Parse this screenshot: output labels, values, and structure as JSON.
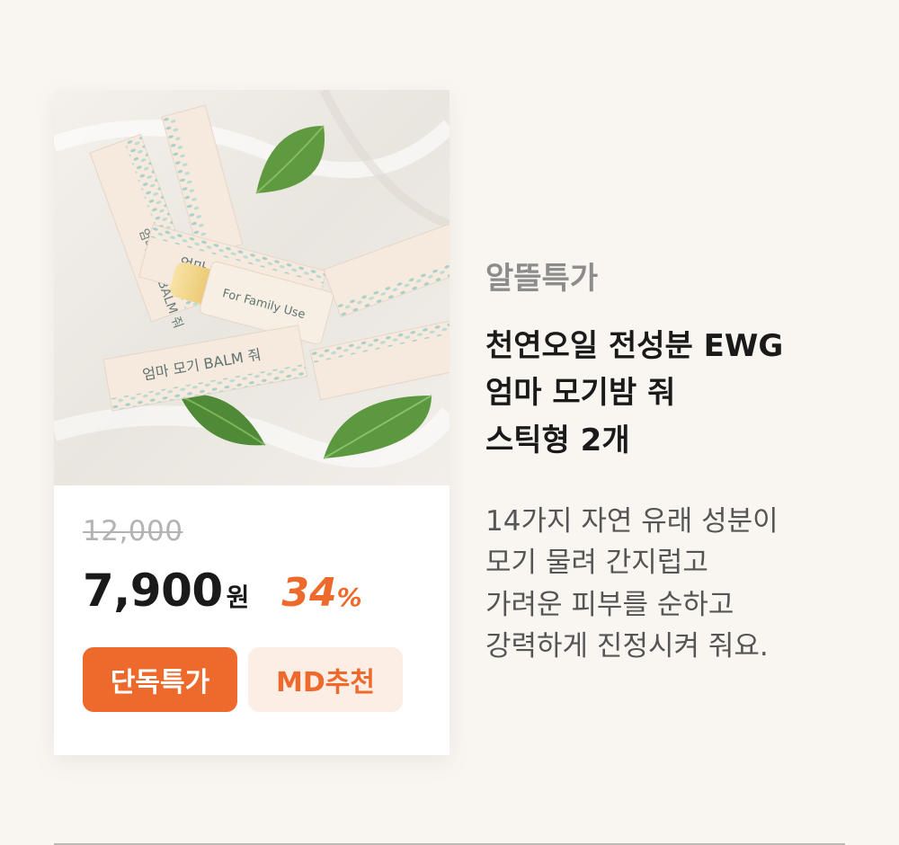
{
  "product": {
    "original_price": "12,000",
    "sale_price": "7,900",
    "currency": "원",
    "discount": "34",
    "discount_unit": "%",
    "badges": [
      {
        "label": "단독특가"
      },
      {
        "label": "MD추천"
      }
    ]
  },
  "info": {
    "category": "알뜰특가",
    "title_lines": [
      "천연오일 전성분 EWG",
      "엄마 모기밤 줘",
      "스틱형 2개"
    ],
    "description_lines": [
      "14가지 자연 유래 성분이",
      "모기 물려 간지럽고",
      "가려운 피부를 순하고",
      "강력하게 진정시켜 줘요."
    ]
  },
  "photo": {
    "box_labels": [
      "엄마 모기 BALM 줘",
      "For Family Use"
    ],
    "colors": {
      "cloth": "#eeeae4",
      "box": "#f6e9de",
      "pattern": "#a8d1c9",
      "leaf": "#5f9a40",
      "balm": "#f3d890"
    }
  },
  "colors": {
    "accent": "#ee6a2c",
    "accent_light": "#fdeee5",
    "background": "#f9f6f2",
    "text_dark": "#1a1a1a",
    "text_muted": "#8c8c8c"
  }
}
